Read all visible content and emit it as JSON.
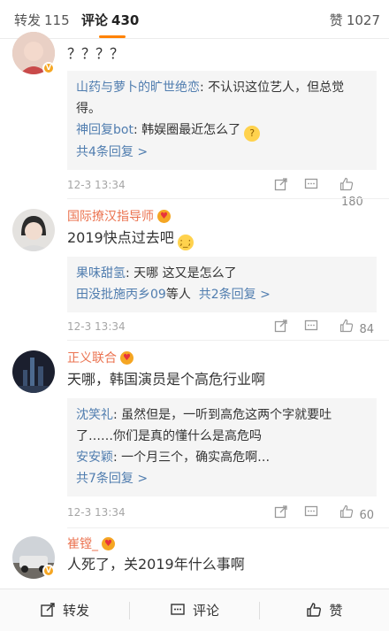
{
  "tabs": {
    "repost_label": "转发",
    "repost_count": "115",
    "comment_label": "评论",
    "comment_count": "430",
    "like_label": "赞",
    "like_count": "1027"
  },
  "accent_color": "#ff8200",
  "comments": [
    {
      "text": "？？？？",
      "replies": [
        {
          "name": "山药与萝卜的旷世绝恋",
          "sep": ":",
          "text": " 不认识这位艺人，但总觉得。"
        },
        {
          "name": "神回复bot",
          "sep": ":",
          "text": " 韩娱圈最近怎么了"
        }
      ],
      "more": "共4条回复 >",
      "time": "12-3 13:34",
      "likes": "180"
    },
    {
      "user": "国际撩汉指导师",
      "text": "2019快点过去吧",
      "replies": [
        {
          "name": "果味甜氢",
          "sep": ":",
          "text": " 天哪 这又是怎么了"
        }
      ],
      "more_users": "田没批施丙乡09",
      "more_users_suffix": "等人",
      "more": "共2条回复 >",
      "time": "12-3 13:34",
      "likes": "84"
    },
    {
      "user": "正义联合",
      "text": "天哪，韩国演员是个高危行业啊",
      "replies": [
        {
          "name": "沈笑礼",
          "sep": ":",
          "text": " 虽然但是，一听到高危这两个字就要吐了……你们是真的懂什么是高危吗"
        },
        {
          "name": "安安颖",
          "sep": ":",
          "text": " 一个月三个，确实高危啊…"
        }
      ],
      "more": "共7条回复 >",
      "time": "12-3 13:34",
      "likes": "60"
    },
    {
      "user": "崔镗_",
      "text": "人死了，关2019年什么事啊"
    }
  ],
  "bottom_bar": {
    "repost": "转发",
    "comment": "评论",
    "like": "赞"
  }
}
